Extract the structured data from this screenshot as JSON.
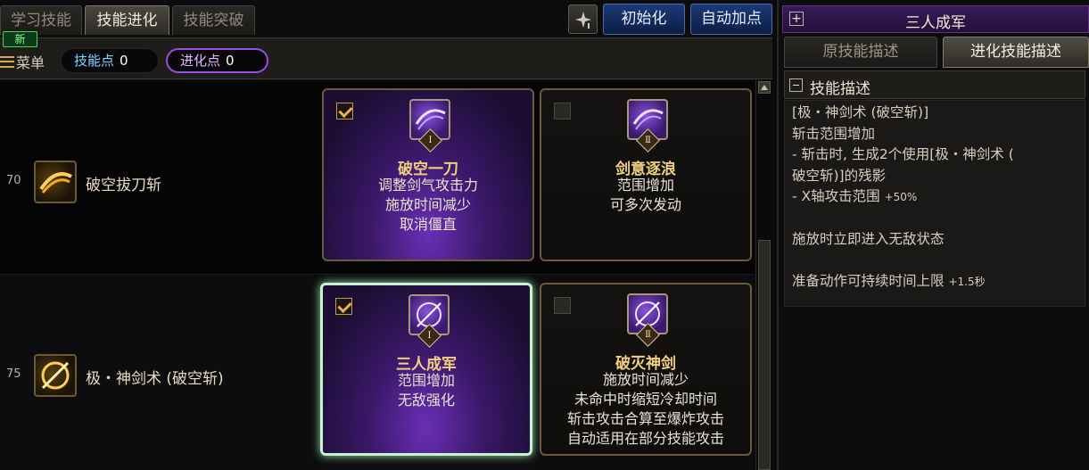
{
  "tabs": {
    "learn": "学习技能",
    "evolve": "技能进化",
    "breakthrough": "技能突破"
  },
  "new_badge": "新",
  "buttons": {
    "reset": "初始化",
    "auto": "自动加点"
  },
  "toolbar": {
    "menu": "菜单",
    "skill_points_label": "技能点",
    "skill_points_value": "0",
    "evo_points_label": "进化点",
    "evo_points_value": "0"
  },
  "rows": [
    {
      "level": "70",
      "name": "破空拔刀斩",
      "options": [
        {
          "checked": true,
          "roman": "Ⅰ",
          "title": "破空一刀",
          "lines": [
            "调整剑气攻击力",
            "施放时间减少",
            "取消僵直"
          ]
        },
        {
          "checked": false,
          "roman": "Ⅱ",
          "title": "剑意逐浪",
          "lines": [
            "范围增加",
            "可多次发动"
          ]
        }
      ]
    },
    {
      "level": "75",
      "name": "极・神剑术 (破空斩)",
      "options": [
        {
          "checked": true,
          "roman": "Ⅰ",
          "title": "三人成军",
          "lines": [
            "范围增加",
            "无敌强化"
          ]
        },
        {
          "checked": false,
          "roman": "Ⅱ",
          "title": "破灭神剑",
          "lines": [
            "施放时间减少",
            "未命中时缩短冷却时间",
            "斩击攻击合算至爆炸攻击",
            "自动适用在部分技能攻击"
          ]
        }
      ]
    }
  ],
  "right_panel": {
    "title": "三人成军",
    "tab_original": "原技能描述",
    "tab_evolved": "进化技能描述",
    "section_label": "技能描述",
    "description": {
      "l1": "[极・神剑术 (破空斩)]",
      "l2": "斩击范围增加",
      "l3": "- 斩击时, 生成2个使用[极・神剑术 (",
      "l4": "破空斩)]的残影",
      "l5a": "- X轴攻击范围 ",
      "l5b": "+50%",
      "l6": "施放时立即进入无敌状态",
      "l7a": "准备动作可持续时间上限 ",
      "l7b": "+1.5秒"
    }
  },
  "colors": {
    "accent_purple": "#9a4de0",
    "selected_border": "#c9f0cf",
    "title_gold": "#f0cf80",
    "button_blue": "#1d3a78"
  }
}
